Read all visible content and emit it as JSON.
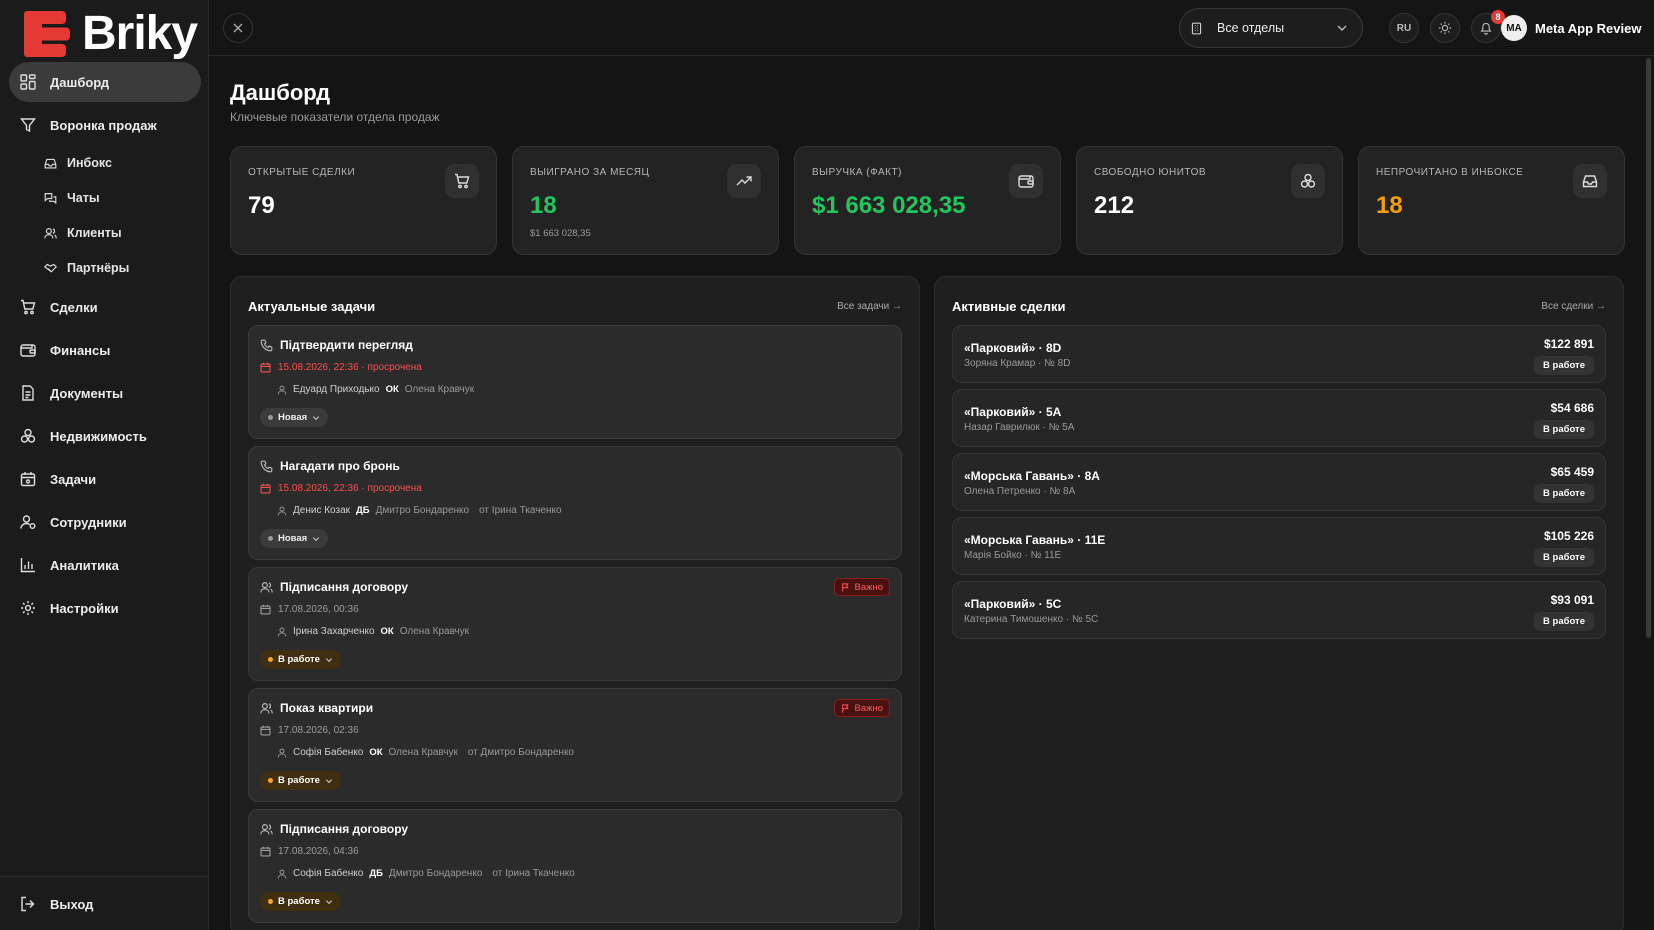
{
  "brand": {
    "name": "Briky",
    "logo_color": "#e53935"
  },
  "sidebar": {
    "items": [
      {
        "label": "Дашборд",
        "icon": "dashboard-icon",
        "active": true
      },
      {
        "label": "Воронка продаж",
        "icon": "funnel-icon"
      },
      {
        "label": "Сделки",
        "icon": "cart-icon"
      },
      {
        "label": "Финансы",
        "icon": "wallet-icon"
      },
      {
        "label": "Документы",
        "icon": "document-icon"
      },
      {
        "label": "Недвижимость",
        "icon": "property-icon"
      },
      {
        "label": "Задачи",
        "icon": "calendar-icon"
      },
      {
        "label": "Сотрудники",
        "icon": "staff-icon"
      },
      {
        "label": "Аналитика",
        "icon": "chart-icon"
      },
      {
        "label": "Настройки",
        "icon": "gear-icon"
      }
    ],
    "sub_items": [
      {
        "label": "Инбокс",
        "icon": "inbox-icon"
      },
      {
        "label": "Чаты",
        "icon": "chat-icon"
      },
      {
        "label": "Клиенты",
        "icon": "clients-icon"
      },
      {
        "label": "Партнёры",
        "icon": "handshake-icon"
      }
    ],
    "logout": "Выход"
  },
  "topbar": {
    "department": "Все отделы",
    "lang": "RU",
    "notifications": "8",
    "user_initials": "MA",
    "user_name": "Meta App Review"
  },
  "page": {
    "title": "Дашборд",
    "subtitle": "Ключевые показатели отдела продаж"
  },
  "stats": [
    {
      "label": "ОТКРЫТЫЕ СДЕЛКИ",
      "value": "79",
      "sub": "",
      "color": "#ffffff",
      "icon": "cart-icon"
    },
    {
      "label": "ВЫИГРАНО ЗА МЕСЯЦ",
      "value": "18",
      "sub": "$1 663 028,35",
      "color": "#22c55e",
      "icon": "trending-up-icon"
    },
    {
      "label": "ВЫРУЧКА (ФАКТ)",
      "value": "$1 663 028,35",
      "sub": "",
      "color": "#22c55e",
      "icon": "wallet-icon"
    },
    {
      "label": "СВОБОДНО ЮНИТОВ",
      "value": "212",
      "sub": "",
      "color": "#ffffff",
      "icon": "units-icon"
    },
    {
      "label": "НЕПРОЧИТАНО В ИНБОКСЕ",
      "value": "18",
      "sub": "",
      "color": "#f59e0b",
      "icon": "inbox-icon"
    }
  ],
  "tasks_panel": {
    "title": "Актуальные задачи",
    "link": "Все задачи →",
    "tasks": [
      {
        "title": "Підтвердити перегляд",
        "type_icon": "phone-icon",
        "date": "15.08.2026, 22:36",
        "overdue": "· просрочена",
        "client": "Едуард Приходько",
        "initials": "ОК",
        "assignee": "Олена Кравчук",
        "from": "",
        "status": "Новая",
        "important": ""
      },
      {
        "title": "Нагадати про бронь",
        "type_icon": "phone-icon",
        "date": "15.08.2026, 22:36",
        "overdue": "· просрочена",
        "client": "Денис Козак",
        "initials": "ДБ",
        "assignee": "Дмитро Бондаренко",
        "from": "от Ірина Ткаченко",
        "status": "Новая",
        "important": ""
      },
      {
        "title": "Підписання договору",
        "type_icon": "meeting-icon",
        "date": "17.08.2026, 00:36",
        "overdue": "",
        "client": "Ірина Захарченко",
        "initials": "ОК",
        "assignee": "Олена Кравчук",
        "from": "",
        "status": "В работе",
        "important": "Важно"
      },
      {
        "title": "Показ квартири",
        "type_icon": "meeting-icon",
        "date": "17.08.2026, 02:36",
        "overdue": "",
        "client": "Софія Бабенко",
        "initials": "ОК",
        "assignee": "Олена Кравчук",
        "from": "от Дмитро Бондаренко",
        "status": "В работе",
        "important": "Важно"
      },
      {
        "title": "Підписання договору",
        "type_icon": "meeting-icon",
        "date": "17.08.2026, 04:36",
        "overdue": "",
        "client": "Софія Бабенко",
        "initials": "ДБ",
        "assignee": "Дмитро Бондаренко",
        "from": "от Ірина Ткаченко",
        "status": "В работе",
        "important": ""
      }
    ]
  },
  "deals_panel": {
    "title": "Активные сделки",
    "link": "Все сделки →",
    "deals": [
      {
        "title": "«Парковий» · 8D",
        "sub": "Зоряна Крамар · № 8D",
        "amount": "$122 891",
        "status": "В работе"
      },
      {
        "title": "«Парковий» · 5A",
        "sub": "Назар Гаврилюк · № 5A",
        "amount": "$54 686",
        "status": "В работе"
      },
      {
        "title": "«Морська Гавань» · 8A",
        "sub": "Олена Петренко · № 8A",
        "amount": "$65 459",
        "status": "В работе"
      },
      {
        "title": "«Морська Гавань» · 11E",
        "sub": "Марія Бойко · № 11E",
        "amount": "$105 226",
        "status": "В работе"
      },
      {
        "title": "«Парковий» · 5C",
        "sub": "Катерина Тимошенко · № 5C",
        "amount": "$93 091",
        "status": "В работе"
      }
    ]
  },
  "colors": {
    "danger": "#ff4d4d",
    "success": "#22c55e",
    "warning": "#f59e0b",
    "in_progress_dot": "#f5a623",
    "new_dot": "#9a9a9a"
  }
}
